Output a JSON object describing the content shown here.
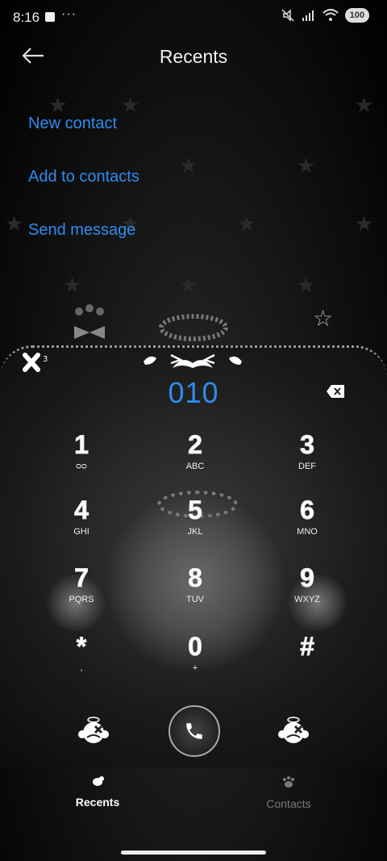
{
  "status_bar": {
    "time": "8:16",
    "more": "···",
    "battery": "100"
  },
  "header": {
    "title": "Recents"
  },
  "actions": [
    {
      "label": "New contact"
    },
    {
      "label": "Add to contacts"
    },
    {
      "label": "Send message"
    }
  ],
  "dialer": {
    "number": "010",
    "keys": [
      {
        "digit": "1",
        "letters": "ᴑᴑ"
      },
      {
        "digit": "2",
        "letters": "ABC"
      },
      {
        "digit": "3",
        "letters": "DEF"
      },
      {
        "digit": "4",
        "letters": "GHI"
      },
      {
        "digit": "5",
        "letters": "JKL"
      },
      {
        "digit": "6",
        "letters": "MNO"
      },
      {
        "digit": "7",
        "letters": "PQRS"
      },
      {
        "digit": "8",
        "letters": "TUV"
      },
      {
        "digit": "9",
        "letters": "WXYZ"
      },
      {
        "digit": "*",
        "letters": ","
      },
      {
        "digit": "0",
        "letters": "+"
      },
      {
        "digit": "#",
        "letters": ""
      }
    ]
  },
  "bottom_nav": [
    {
      "label": "Recents",
      "active": true
    },
    {
      "label": "Contacts",
      "active": false
    }
  ],
  "colors": {
    "accent": "#2d8cf0",
    "inactive": "#7a7a7a"
  }
}
